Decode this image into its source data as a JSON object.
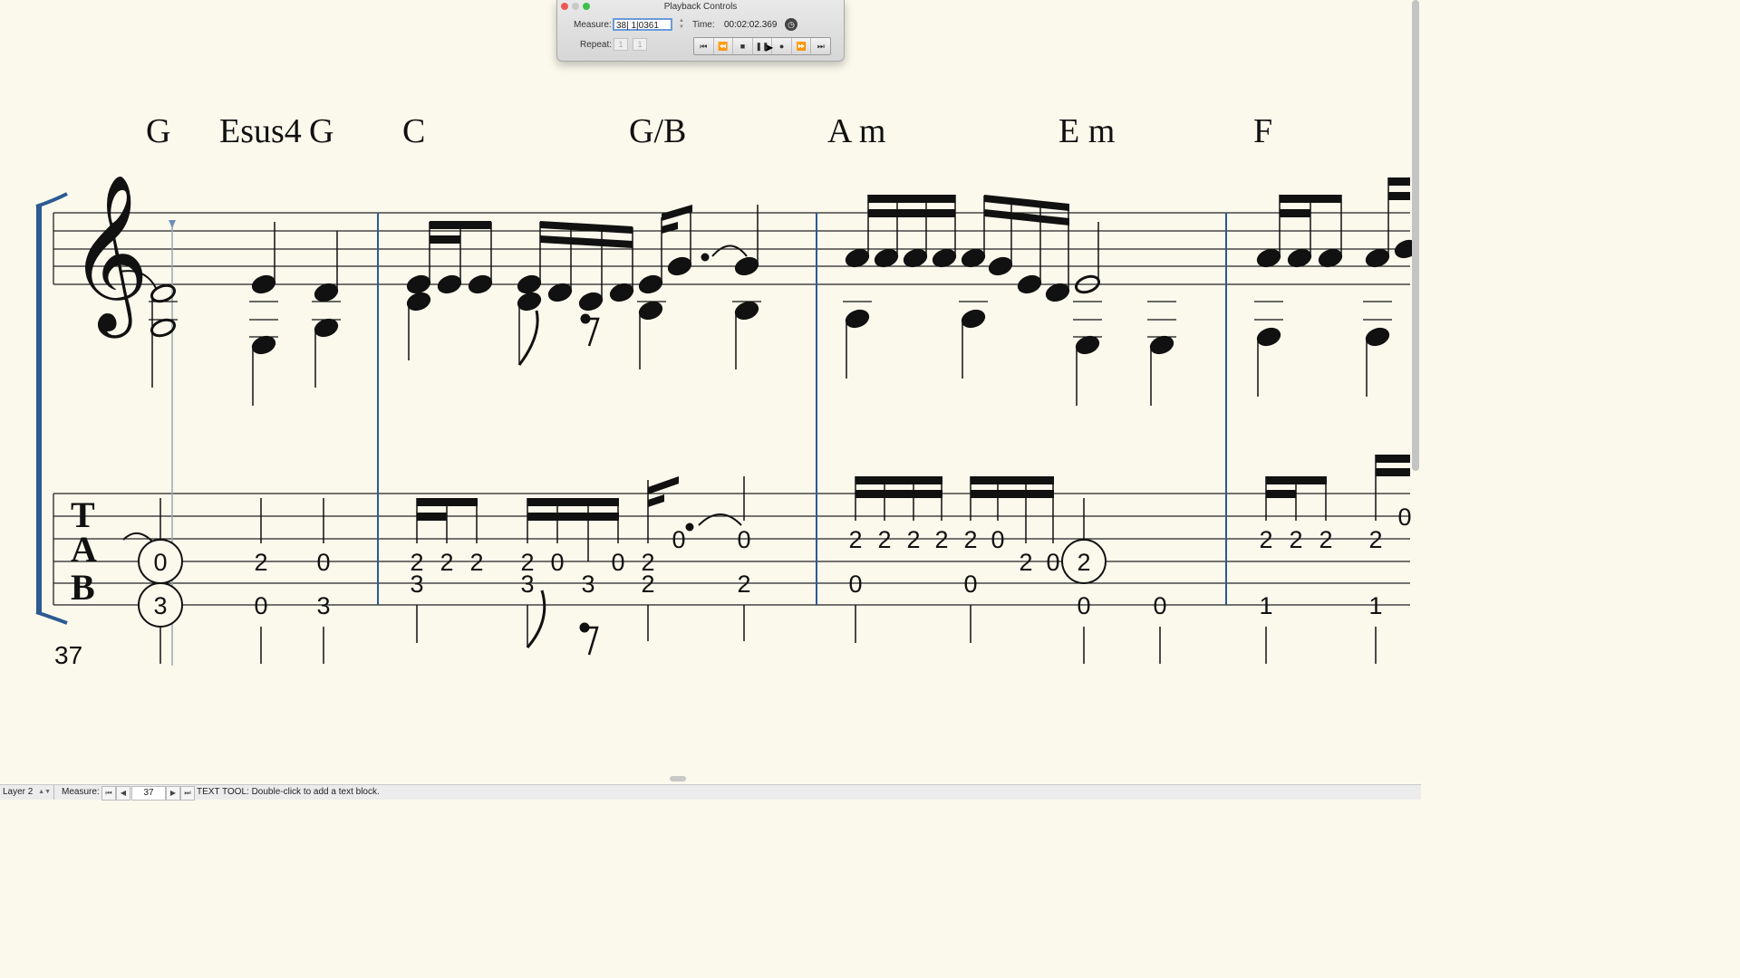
{
  "playback": {
    "title": "Playback Controls",
    "measure_label": "Measure:",
    "measure_value": "38| 1|0361",
    "time_label": "Time:",
    "time_value": "00:02:02.369",
    "repeat_label": "Repeat:",
    "repeat_from": "1",
    "repeat_to": "1",
    "buttons": [
      "rewind-to-start",
      "rewind",
      "stop",
      "pause",
      "record",
      "fast-forward",
      "fast-forward-to-end"
    ]
  },
  "score": {
    "chords": [
      "G",
      "Esus4",
      "G",
      "C",
      "G/B",
      "A m",
      "E m",
      "F"
    ],
    "tab_letters": [
      "T",
      "A",
      "B"
    ],
    "measure_number": "37",
    "tab_numbers": {
      "m37": [
        "0",
        "3",
        "2",
        "0",
        "0",
        "3"
      ],
      "m38": [
        "2",
        "2",
        "2",
        "3",
        "2",
        "0",
        "3",
        "0",
        "3",
        "2",
        "2",
        "0",
        "0",
        "2"
      ],
      "m39": [
        "2",
        "2",
        "2",
        "2",
        "2",
        "0",
        "0",
        "0",
        "2",
        "0",
        "2",
        "0",
        "0"
      ],
      "m40": [
        "2",
        "2",
        "2",
        "2",
        "1",
        "1",
        "0"
      ]
    }
  },
  "statusbar": {
    "layer": "Layer 2",
    "measure_label": "Measure:",
    "measure_value": "37",
    "message": "TEXT TOOL: Double-click to add a text block."
  }
}
